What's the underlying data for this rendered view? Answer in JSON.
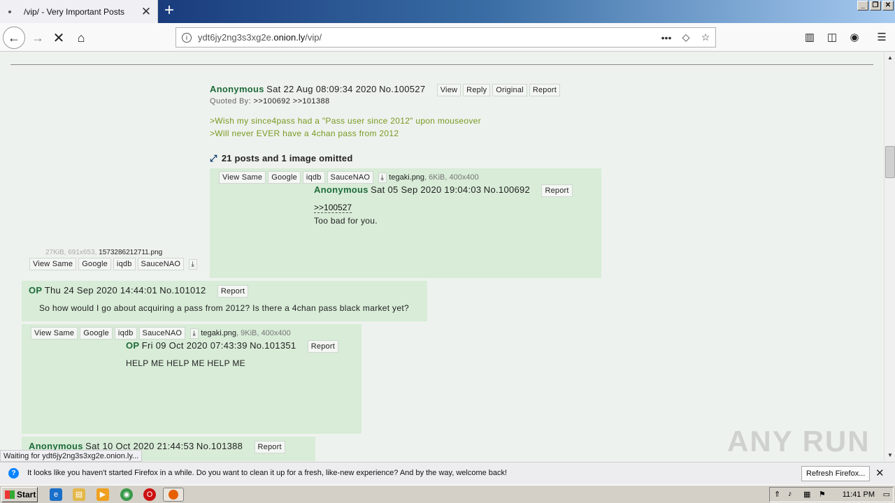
{
  "browser": {
    "tab_title": "/vip/ - Very Important Posts",
    "url_prefix": "ydt6jy2ng3s3xg2e.",
    "url_domain": "onion.ly",
    "url_path": "/vip/",
    "status_text": "Waiting for ydt6jy2ng3s3xg2e.onion.ly...",
    "watermark": "ANY RUN"
  },
  "post1": {
    "name": "Anonymous",
    "datetime": "Sat 22 Aug 08:09:34 2020",
    "number": "No.100527",
    "buttons": [
      "View",
      "Reply",
      "Original",
      "Report"
    ],
    "quoted_by_label": "Quoted By:",
    "quoted_by": [
      ">>100692",
      ">>101388"
    ],
    "lines": [
      ">Wish my since4pass had a \"Pass user since 2012\" upon mouseover",
      ">Will never EVER have a 4chan pass from 2012"
    ]
  },
  "omitted": {
    "text": "21 posts and 1 image omitted"
  },
  "left_file": {
    "info": "27KiB, 691x653,",
    "filename": "1573286212711.png",
    "buttons": [
      "View Same",
      "Google",
      "iqdb",
      "SauceNAO"
    ]
  },
  "post2": {
    "file_buttons": [
      "View Same",
      "Google",
      "iqdb",
      "SauceNAO"
    ],
    "filename": "tegaki.png",
    "fileinfo": ", 6KiB, 400x400",
    "name": "Anonymous",
    "datetime": "Sat 05 Sep 2020 19:04:03",
    "number": "No.100692",
    "report": "Report",
    "quote": ">>100527",
    "message": "Too bad for you."
  },
  "post3": {
    "name": "OP",
    "datetime": "Thu 24 Sep 2020 14:44:01",
    "number": "No.101012",
    "report": "Report",
    "message": "So how would I go about acquiring a pass from 2012? Is there a 4chan pass black market yet?"
  },
  "post4": {
    "file_buttons": [
      "View Same",
      "Google",
      "iqdb",
      "SauceNAO"
    ],
    "filename": "tegaki.png",
    "fileinfo": ", 9KiB, 400x400",
    "name": "OP",
    "datetime": "Fri 09 Oct 2020 07:43:39",
    "number": "No.101351",
    "report": "Report",
    "message": "HELP ME HELP ME HELP ME"
  },
  "post5": {
    "name": "Anonymous",
    "datetime": "Sat 10 Oct 2020 21:44:53",
    "number": "No.101388",
    "report": "Report"
  },
  "notification": {
    "text": "It looks like you haven't started Firefox in a while. Do you want to clean it up for a fresh, like-new experience? And by the way, welcome back!",
    "button": "Refresh Firefox..."
  },
  "taskbar": {
    "start": "Start",
    "clock": "11:41 PM"
  }
}
